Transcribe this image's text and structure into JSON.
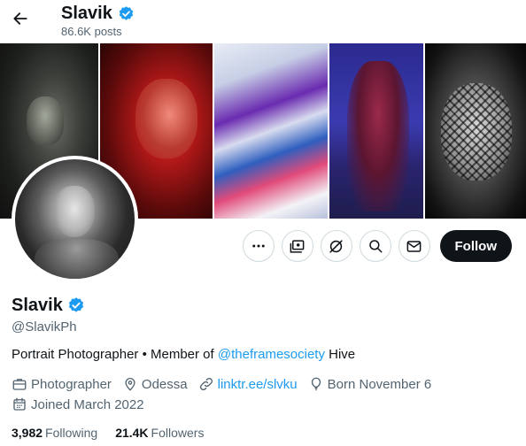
{
  "header": {
    "name": "Slavik",
    "posts_count": "86.6K posts"
  },
  "profile": {
    "name": "Slavik",
    "handle": "@SlavikPh",
    "verified": true,
    "bio": {
      "text_before": "Portrait Photographer • Member of ",
      "mention": "@theframesociety",
      "text_after": " Hive"
    },
    "meta": {
      "category": "Photographer",
      "location": "Odessa",
      "website": "linktr.ee/slvku",
      "born": "Born November 6",
      "joined": "Joined March 2022"
    },
    "stats": {
      "following_count": "3,982",
      "following_label": "Following",
      "followers_count": "21.4K",
      "followers_label": "Followers"
    }
  },
  "actions": {
    "follow_label": "Follow",
    "icons": [
      "more-icon",
      "subscriptions-icon",
      "grok-icon",
      "search-icon",
      "message-icon"
    ]
  },
  "colors": {
    "accent": "#1d9bf0",
    "verified": "#1d9bf0",
    "follow_bg": "#0f1419",
    "secondary_text": "#536471",
    "border": "#cfd9de"
  }
}
